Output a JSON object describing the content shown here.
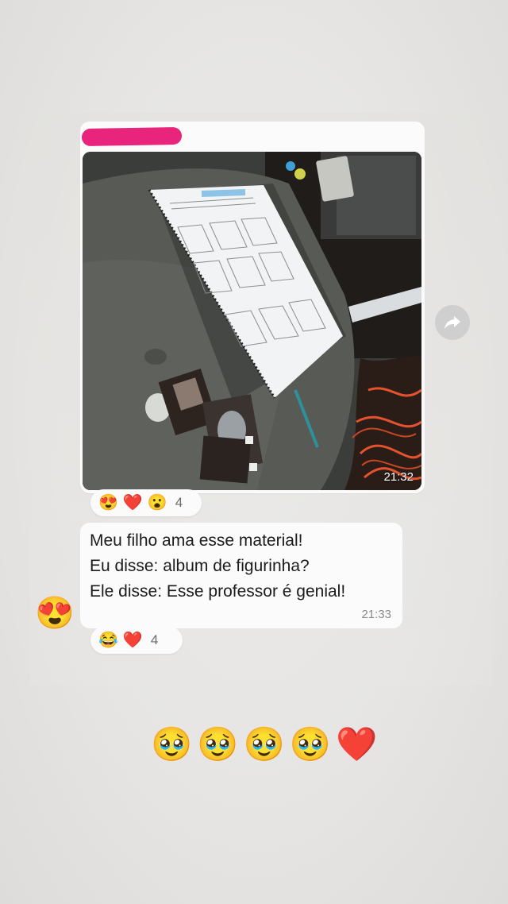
{
  "image_message": {
    "sender_name": "",
    "time": "21:32",
    "reactions": [
      "😍",
      "❤️",
      "😮"
    ],
    "reaction_count": "4"
  },
  "text_message": {
    "lines": [
      "Meu filho ama esse material!",
      "Eu disse: album de figurinha?",
      "Ele disse: Esse professor é genial!"
    ],
    "time": "21:33",
    "reactions": [
      "😂",
      "❤️"
    ],
    "reaction_count": "4"
  },
  "overlay": {
    "side_emoji": "😍",
    "bottom_emojis": [
      "🥹",
      "🥹",
      "🥹",
      "🥹",
      "❤️"
    ]
  },
  "icons": {
    "forward": "forward-arrow-icon"
  },
  "colors": {
    "bubble": "#fbfbfb",
    "sender_name": "#e0407d",
    "redaction": "#e8247c",
    "time_text": "#8b8b8b"
  }
}
